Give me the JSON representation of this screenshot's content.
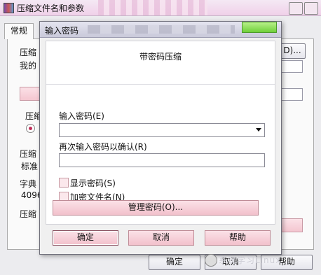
{
  "background_window": {
    "title": "压缩文件名和参数",
    "tab_active": "常规",
    "labels": {
      "archive_name": "压缩",
      "archive_path": "我的",
      "compress_method_group": "压缩",
      "format_label": "压缩",
      "format_value": "标准",
      "dict_label": "字典",
      "dict_value": "4096",
      "split_label": "压缩"
    },
    "browse_button": "D)...",
    "ok_button": "确定",
    "cancel_button": "取消",
    "help_button": "帮助"
  },
  "dialog": {
    "title": "输入密码",
    "heading": "带密码压缩",
    "password_label": "输入密码(E)",
    "password_value": "",
    "confirm_label": "再次输入密码以确认(R)",
    "confirm_value": "",
    "show_password": {
      "label": "显示密码(S)",
      "checked": false
    },
    "encrypt_names": {
      "label": "加密文件名(N)",
      "checked": false
    },
    "manage_button": "管理密码(O)...",
    "ok_button": "确定",
    "cancel_button": "取消",
    "help_button": "帮助"
  },
  "watermark": {
    "text": "系统学习Linux"
  }
}
